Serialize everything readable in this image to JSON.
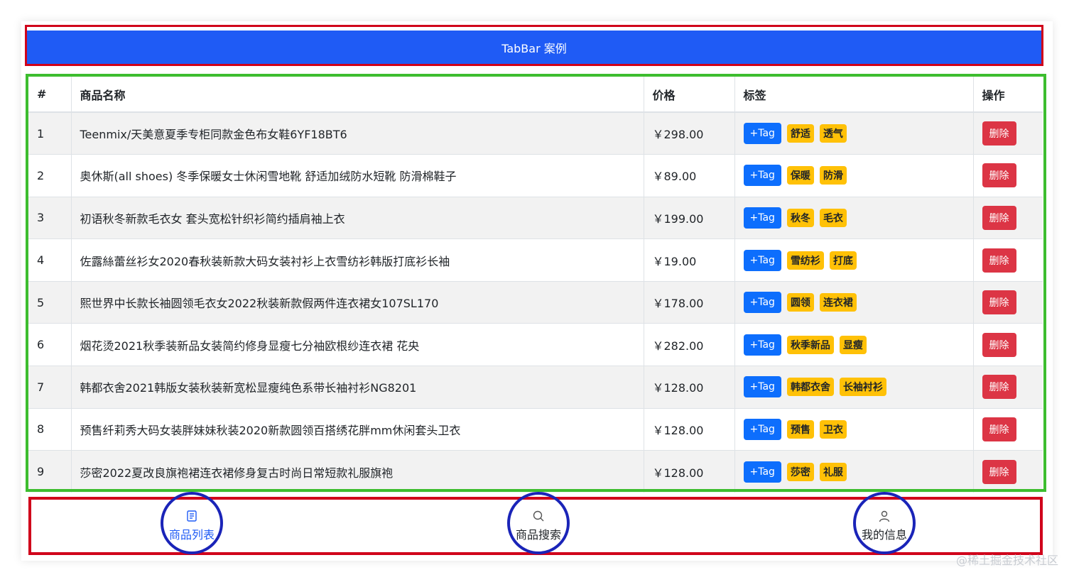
{
  "header": {
    "title": "TabBar 案例"
  },
  "table": {
    "columns": [
      "#",
      "商品名称",
      "价格",
      "标签",
      "操作"
    ],
    "add_tag_label": "+Tag",
    "delete_label": "删除",
    "rows": [
      {
        "id": "1",
        "name": "Teenmix/天美意夏季专柜同款金色布女鞋6YF18BT6",
        "price": "￥298.00",
        "tags": [
          "舒适",
          "透气"
        ]
      },
      {
        "id": "2",
        "name": "奥休斯(all shoes) 冬季保暖女士休闲雪地靴 舒适加绒防水短靴 防滑棉鞋子",
        "price": "￥89.00",
        "tags": [
          "保暖",
          "防滑"
        ]
      },
      {
        "id": "3",
        "name": "初语秋冬新款毛衣女 套头宽松针织衫简约插肩袖上衣",
        "price": "￥199.00",
        "tags": [
          "秋冬",
          "毛衣"
        ]
      },
      {
        "id": "4",
        "name": "佐露絲蕾丝衫女2020春秋装新款大码女装衬衫上衣雪纺衫韩版打底衫长袖",
        "price": "￥19.00",
        "tags": [
          "雪纺衫",
          "打底"
        ]
      },
      {
        "id": "5",
        "name": "熙世界中长款长袖圆领毛衣女2022秋装新款假两件连衣裙女107SL170",
        "price": "￥178.00",
        "tags": [
          "圆领",
          "连衣裙"
        ]
      },
      {
        "id": "6",
        "name": "烟花烫2021秋季装新品女装简约修身显瘦七分袖欧根纱连衣裙 花央",
        "price": "￥282.00",
        "tags": [
          "秋季新品",
          "显瘦"
        ]
      },
      {
        "id": "7",
        "name": "韩都衣舍2021韩版女装秋装新宽松显瘦纯色系带长袖衬衫NG8201",
        "price": "￥128.00",
        "tags": [
          "韩都衣舍",
          "长袖衬衫"
        ]
      },
      {
        "id": "8",
        "name": "预售纤莉秀大码女装胖妹妹秋装2020新款圆领百搭绣花胖mm休闲套头卫衣",
        "price": "￥128.00",
        "tags": [
          "预售",
          "卫衣"
        ]
      },
      {
        "id": "9",
        "name": "莎密2022夏改良旗袍裙连衣裙修身复古时尚日常短款礼服旗袍",
        "price": "￥128.00",
        "tags": [
          "莎密",
          "礼服"
        ]
      }
    ]
  },
  "tabbar": {
    "items": [
      {
        "label": "商品列表",
        "icon": "list-icon",
        "active": true
      },
      {
        "label": "商品搜索",
        "icon": "search-icon",
        "active": false
      },
      {
        "label": "我的信息",
        "icon": "user-icon",
        "active": false
      }
    ]
  },
  "watermark": "@稀土掘金技术社区",
  "colors": {
    "header_bg": "#1f5bf5",
    "primary_button": "#0d6efd",
    "danger_button": "#dc3545",
    "badge": "#ffc107",
    "annotation_red": "#d0021b",
    "annotation_green": "#3dbd2f",
    "annotation_blue": "#1a24b8"
  }
}
